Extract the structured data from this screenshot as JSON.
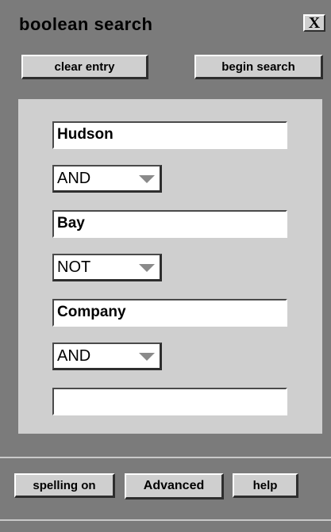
{
  "window": {
    "title": "boolean search",
    "close_label": "X"
  },
  "toolbar": {
    "clear_label": "clear entry",
    "begin_label": "begin search"
  },
  "query": {
    "terms": [
      "Hudson",
      "Bay",
      "Company",
      ""
    ],
    "operators": [
      "AND",
      "NOT",
      "AND"
    ]
  },
  "footer": {
    "spelling_label": "spelling on",
    "advanced_label": "Advanced",
    "help_label": "help"
  },
  "colors": {
    "panel_bg": "#7b7b7b",
    "inner_bg": "#cfcfcf",
    "button_face": "#cfcfcf"
  },
  "icons": [
    "close-icon",
    "dropdown-arrow-icon"
  ]
}
